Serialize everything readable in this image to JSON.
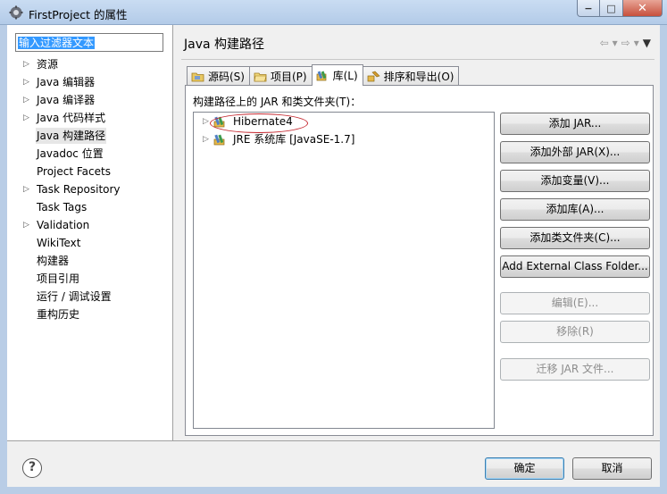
{
  "window": {
    "title": "FirstProject 的属性",
    "controls": {
      "minimize": "−",
      "maximize": "□",
      "close": "✕"
    }
  },
  "filter": {
    "value": "输入过滤器文本"
  },
  "sidebar": {
    "items": [
      {
        "label": "资源",
        "expandable": true
      },
      {
        "label": "Java 编辑器",
        "expandable": true
      },
      {
        "label": "Java 编译器",
        "expandable": true
      },
      {
        "label": "Java 代码样式",
        "expandable": true
      },
      {
        "label": "Java 构建路径",
        "expandable": false,
        "selected": true
      },
      {
        "label": "Javadoc 位置",
        "expandable": false
      },
      {
        "label": "Project Facets",
        "expandable": false
      },
      {
        "label": "Task Repository",
        "expandable": true
      },
      {
        "label": "Task Tags",
        "expandable": false
      },
      {
        "label": "Validation",
        "expandable": true
      },
      {
        "label": "WikiText",
        "expandable": false
      },
      {
        "label": "构建器",
        "expandable": false
      },
      {
        "label": "项目引用",
        "expandable": false
      },
      {
        "label": "运行 / 调试设置",
        "expandable": false
      },
      {
        "label": "重构历史",
        "expandable": false
      }
    ]
  },
  "page": {
    "title": "Java 构建路径",
    "nav": {
      "back": "⇦",
      "back_menu": "▾",
      "forward": "⇨",
      "forward_menu": "▾",
      "view_menu": "▼"
    }
  },
  "tabs": [
    {
      "label": "源码(S)",
      "icon": "source-folder-icon"
    },
    {
      "label": "项目(P)",
      "icon": "project-folder-icon"
    },
    {
      "label": "库(L)",
      "icon": "library-icon",
      "active": true
    },
    {
      "label": "排序和导出(O)",
      "icon": "order-export-icon"
    }
  ],
  "libraries": {
    "label": "构建路径上的 JAR 和类文件夹(T)：",
    "items": [
      {
        "label": "Hibernate4"
      },
      {
        "label": "JRE 系统库 [JavaSE-1.7]"
      }
    ]
  },
  "buttons": {
    "add_jar": "添加 JAR...",
    "add_external_jar": "添加外部 JAR(X)...",
    "add_variable": "添加变量(V)...",
    "add_library": "添加库(A)...",
    "add_class_folder": "添加类文件夹(C)...",
    "add_external_class_folder": "Add External Class Folder...",
    "edit": "编辑(E)...",
    "remove": "移除(R)",
    "migrate_jar": "迁移 JAR 文件..."
  },
  "footer": {
    "help": "?",
    "ok": "确定",
    "cancel": "取消"
  },
  "colors": {
    "annotation": "#c4262e",
    "selection": "#3399ff",
    "titlebar": "#b3cbe8"
  }
}
